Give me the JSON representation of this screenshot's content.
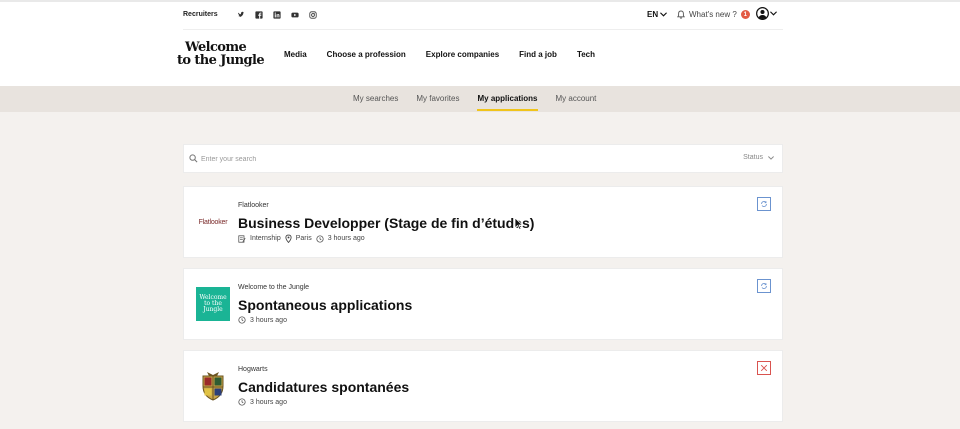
{
  "header": {
    "recruiters": "Recruiters",
    "social_icons": [
      "twitter-icon",
      "facebook-icon",
      "linkedin-icon",
      "youtube-icon",
      "instagram-icon"
    ],
    "language": "EN",
    "whats_new": "What's new ?",
    "whats_new_count": "1",
    "logo_line1": "Welcome",
    "logo_line2": "to the Jungle",
    "nav": [
      "Media",
      "Choose a profession",
      "Explore companies",
      "Find a job",
      "Tech"
    ]
  },
  "subnav": {
    "items": [
      "My searches",
      "My favorites",
      "My applications",
      "My account"
    ],
    "active": "My applications"
  },
  "search": {
    "placeholder": "Enter your search",
    "status_label": "Status"
  },
  "applications": [
    {
      "company": "Flatlooker",
      "logo_text": "Flatlooker",
      "title": "Business Developper (Stage de fin d’études)",
      "contract": "Internship",
      "location": "Paris",
      "time": "3 hours ago",
      "status_icon": "pending-icon"
    },
    {
      "company": "Welcome to the Jungle",
      "logo_text": "Welcome to the Jungle",
      "title": "Spontaneous applications",
      "time": "3 hours ago",
      "status_icon": "pending-icon"
    },
    {
      "company": "Hogwarts",
      "title": "Candidatures spontanées",
      "time": "3 hours ago",
      "status_icon": "rejected-icon"
    }
  ],
  "colors": {
    "accent": "#f0c41b",
    "background": "#f4f1ee",
    "subnav_bg": "#e8e3de",
    "pending": "#6b93cf",
    "rejected": "#d9534f",
    "wttj_green": "#1ab495"
  }
}
